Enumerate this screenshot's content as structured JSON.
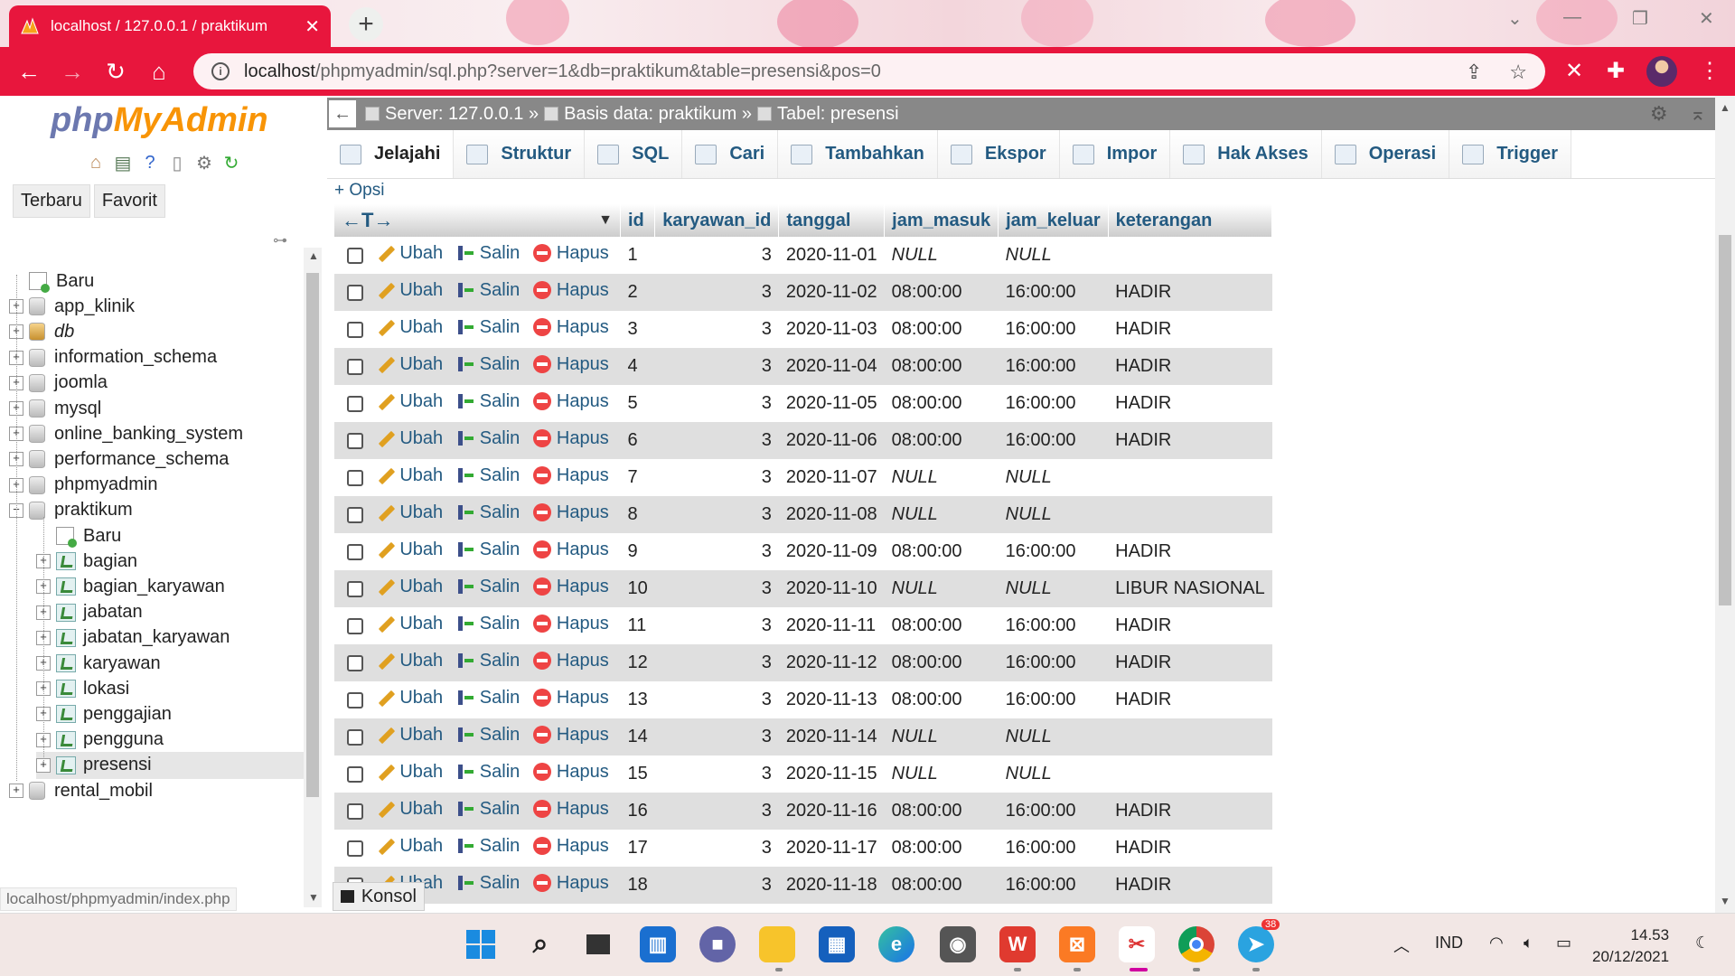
{
  "browser": {
    "tab_title": "localhost / 127.0.0.1 / praktikum",
    "url_host": "localhost",
    "url_path": "/phpmyadmin/sql.php?server=1&db=praktikum&table=presensi&pos=0",
    "accent_color": "#e8163d"
  },
  "sidebar": {
    "logo_php": "php",
    "logo_myadmin": "MyAdmin",
    "recent_label": "Terbaru",
    "favorite_label": "Favorit",
    "tree": [
      {
        "label": "Baru",
        "type": "new",
        "level": 0
      },
      {
        "label": "app_klinik",
        "type": "db",
        "level": 0
      },
      {
        "label": "db",
        "type": "db-special",
        "level": 0
      },
      {
        "label": "information_schema",
        "type": "db",
        "level": 0
      },
      {
        "label": "joomla",
        "type": "db",
        "level": 0
      },
      {
        "label": "mysql",
        "type": "db",
        "level": 0
      },
      {
        "label": "online_banking_system",
        "type": "db",
        "level": 0
      },
      {
        "label": "performance_schema",
        "type": "db",
        "level": 0
      },
      {
        "label": "phpmyadmin",
        "type": "db",
        "level": 0
      },
      {
        "label": "praktikum",
        "type": "db-open",
        "level": 0
      },
      {
        "label": "Baru",
        "type": "new",
        "level": 1
      },
      {
        "label": "bagian",
        "type": "table",
        "level": 1
      },
      {
        "label": "bagian_karyawan",
        "type": "table",
        "level": 1
      },
      {
        "label": "jabatan",
        "type": "table",
        "level": 1
      },
      {
        "label": "jabatan_karyawan",
        "type": "table",
        "level": 1
      },
      {
        "label": "karyawan",
        "type": "table",
        "level": 1
      },
      {
        "label": "lokasi",
        "type": "table",
        "level": 1
      },
      {
        "label": "penggajian",
        "type": "table",
        "level": 1
      },
      {
        "label": "pengguna",
        "type": "table",
        "level": 1
      },
      {
        "label": "presensi",
        "type": "table-selected",
        "level": 1
      },
      {
        "label": "rental_mobil",
        "type": "db",
        "level": 0
      }
    ],
    "status_url": "localhost/phpmyadmin/index.php"
  },
  "breadcrumb": {
    "server": "Server: 127.0.0.1 »",
    "database": "Basis data: praktikum »",
    "table": "Tabel: presensi"
  },
  "tabs": [
    "Jelajahi",
    "Struktur",
    "SQL",
    "Cari",
    "Tambahkan",
    "Ekspor",
    "Impor",
    "Hak Akses",
    "Operasi",
    "Trigger"
  ],
  "options_link": "+ Opsi",
  "grid": {
    "columns": [
      "id",
      "karyawan_id",
      "tanggal",
      "jam_masuk",
      "jam_keluar",
      "keterangan"
    ],
    "action_edit": "Ubah",
    "action_copy": "Salin",
    "action_delete": "Hapus",
    "rows": [
      [
        "1",
        "3",
        "2020-11-01",
        "NULL",
        "NULL",
        ""
      ],
      [
        "2",
        "3",
        "2020-11-02",
        "08:00:00",
        "16:00:00",
        "HADIR"
      ],
      [
        "3",
        "3",
        "2020-11-03",
        "08:00:00",
        "16:00:00",
        "HADIR"
      ],
      [
        "4",
        "3",
        "2020-11-04",
        "08:00:00",
        "16:00:00",
        "HADIR"
      ],
      [
        "5",
        "3",
        "2020-11-05",
        "08:00:00",
        "16:00:00",
        "HADIR"
      ],
      [
        "6",
        "3",
        "2020-11-06",
        "08:00:00",
        "16:00:00",
        "HADIR"
      ],
      [
        "7",
        "3",
        "2020-11-07",
        "NULL",
        "NULL",
        ""
      ],
      [
        "8",
        "3",
        "2020-11-08",
        "NULL",
        "NULL",
        ""
      ],
      [
        "9",
        "3",
        "2020-11-09",
        "08:00:00",
        "16:00:00",
        "HADIR"
      ],
      [
        "10",
        "3",
        "2020-11-10",
        "NULL",
        "NULL",
        "LIBUR NASIONAL"
      ],
      [
        "11",
        "3",
        "2020-11-11",
        "08:00:00",
        "16:00:00",
        "HADIR"
      ],
      [
        "12",
        "3",
        "2020-11-12",
        "08:00:00",
        "16:00:00",
        "HADIR"
      ],
      [
        "13",
        "3",
        "2020-11-13",
        "08:00:00",
        "16:00:00",
        "HADIR"
      ],
      [
        "14",
        "3",
        "2020-11-14",
        "NULL",
        "NULL",
        ""
      ],
      [
        "15",
        "3",
        "2020-11-15",
        "NULL",
        "NULL",
        ""
      ],
      [
        "16",
        "3",
        "2020-11-16",
        "08:00:00",
        "16:00:00",
        "HADIR"
      ],
      [
        "17",
        "3",
        "2020-11-17",
        "08:00:00",
        "16:00:00",
        "HADIR"
      ],
      [
        "18",
        "3",
        "2020-11-18",
        "08:00:00",
        "16:00:00",
        "HADIR"
      ]
    ]
  },
  "console_label": "Konsol",
  "taskbar": {
    "language": "IND",
    "time": "14.53",
    "date": "20/12/2021",
    "telegram_badge": "38"
  }
}
